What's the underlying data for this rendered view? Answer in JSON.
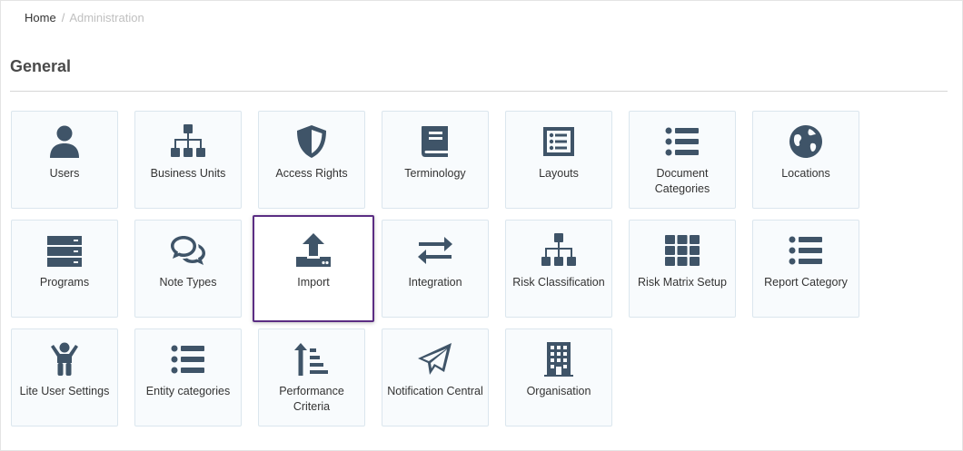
{
  "breadcrumb": {
    "home": "Home",
    "separator": "/",
    "current": "Administration"
  },
  "section": {
    "title": "General"
  },
  "colors": {
    "icon": "#3f5468",
    "selected_border": "#5b2d83",
    "tile_bg": "#f8fbfd",
    "tile_border": "#dbe6ee"
  },
  "tiles": [
    {
      "label": "Users",
      "icon": "user-icon"
    },
    {
      "label": "Business Units",
      "icon": "sitemap-icon"
    },
    {
      "label": "Access Rights",
      "icon": "shield-icon"
    },
    {
      "label": "Terminology",
      "icon": "book-icon"
    },
    {
      "label": "Layouts",
      "icon": "list-alt-icon"
    },
    {
      "label": "Document Categories",
      "icon": "list-icon"
    },
    {
      "label": "Locations",
      "icon": "globe-icon"
    },
    {
      "label": "Programs",
      "icon": "server-icon"
    },
    {
      "label": "Note Types",
      "icon": "comments-icon"
    },
    {
      "label": "Import",
      "icon": "upload-icon",
      "selected": true
    },
    {
      "label": "Integration",
      "icon": "exchange-icon"
    },
    {
      "label": "Risk Classification",
      "icon": "sitemap-icon"
    },
    {
      "label": "Risk Matrix Setup",
      "icon": "grid-icon"
    },
    {
      "label": "Report Category",
      "icon": "list-icon"
    },
    {
      "label": "Lite User Settings",
      "icon": "child-icon"
    },
    {
      "label": "Entity categories",
      "icon": "list-icon"
    },
    {
      "label": "Performance Criteria",
      "icon": "sort-amount-icon"
    },
    {
      "label": "Notification Central",
      "icon": "paper-plane-icon"
    },
    {
      "label": "Organisation",
      "icon": "building-icon"
    }
  ]
}
